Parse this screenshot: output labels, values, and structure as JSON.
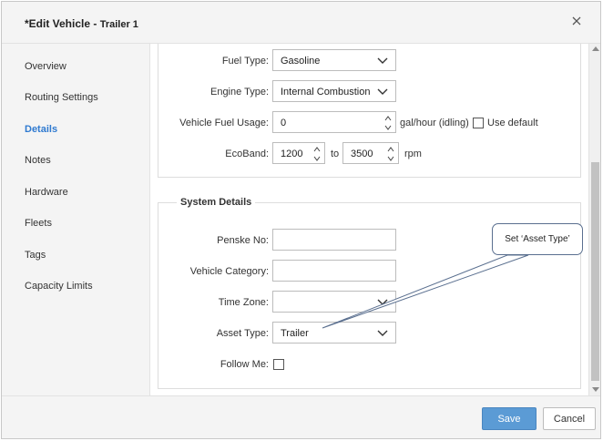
{
  "header": {
    "title": "*Edit Vehicle - ",
    "vehicle_name": "Trailer 1"
  },
  "sidebar": {
    "items": [
      {
        "label": "Overview"
      },
      {
        "label": "Routing Settings"
      },
      {
        "label": "Details"
      },
      {
        "label": "Notes"
      },
      {
        "label": "Hardware"
      },
      {
        "label": "Fleets"
      },
      {
        "label": "Tags"
      },
      {
        "label": "Capacity Limits"
      }
    ],
    "active": "Details"
  },
  "fuel_section": {
    "fuel_type": {
      "label": "Fuel Type:",
      "value": "Gasoline"
    },
    "engine_type": {
      "label": "Engine Type:",
      "value": "Internal Combustion"
    },
    "fuel_usage": {
      "label": "Vehicle Fuel Usage:",
      "value": "0",
      "unit": "gal/hour (idling)",
      "use_default_label": "Use default"
    },
    "ecoband": {
      "label": "EcoBand:",
      "min": "1200",
      "to_label": "to",
      "max": "3500",
      "unit": "rpm"
    }
  },
  "system_details": {
    "title": "System Details",
    "penske_no": {
      "label": "Penske No:",
      "value": ""
    },
    "vehicle_category": {
      "label": "Vehicle Category:",
      "value": ""
    },
    "time_zone": {
      "label": "Time Zone:",
      "value": ""
    },
    "asset_type": {
      "label": "Asset Type:",
      "value": "Trailer"
    },
    "follow_me": {
      "label": "Follow Me:"
    }
  },
  "callout": {
    "text": "Set ‘Asset Type’"
  },
  "footer": {
    "save_label": "Save",
    "cancel_label": "Cancel"
  },
  "colors": {
    "accent": "#2f7ad0",
    "save_button": "#5b9bd5",
    "callout_border": "#5a6f8f"
  },
  "icons": {
    "close": "close-icon",
    "dropdown": "chevron-down-icon",
    "spinner": "spinner-arrows-icon"
  }
}
